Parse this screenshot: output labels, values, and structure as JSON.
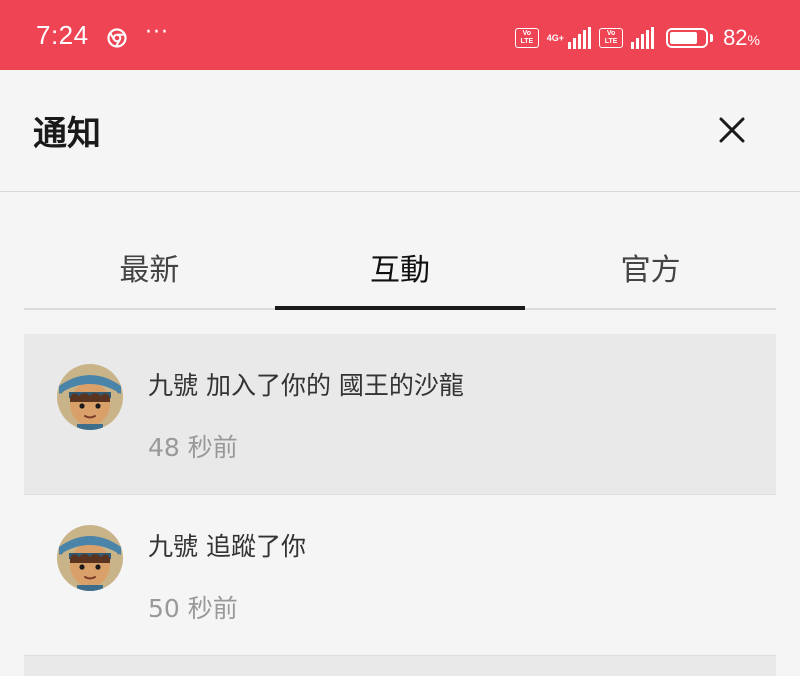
{
  "status_bar": {
    "time": "7:24",
    "more": "···",
    "volte_label": "Vo LTE",
    "network": "4G+",
    "battery_percent": 82,
    "battery_number": "82",
    "battery_unit": "%"
  },
  "header": {
    "title": "通知"
  },
  "tabs": [
    {
      "label": "最新",
      "active": false
    },
    {
      "label": "互動",
      "active": true
    },
    {
      "label": "官方",
      "active": false
    }
  ],
  "notifications": [
    {
      "text": "九號 加入了你的 國王的沙龍",
      "time": "48 秒前",
      "unread": true,
      "avatar": "character-avatar"
    },
    {
      "text": "九號 追蹤了你",
      "time": "50 秒前",
      "unread": false,
      "avatar": "character-avatar"
    }
  ],
  "colors": {
    "status_bar": "#ef4454",
    "background": "#f5f5f5",
    "unread_row": "#e9e9e9",
    "avatar_hat": "#3d6e8c"
  }
}
